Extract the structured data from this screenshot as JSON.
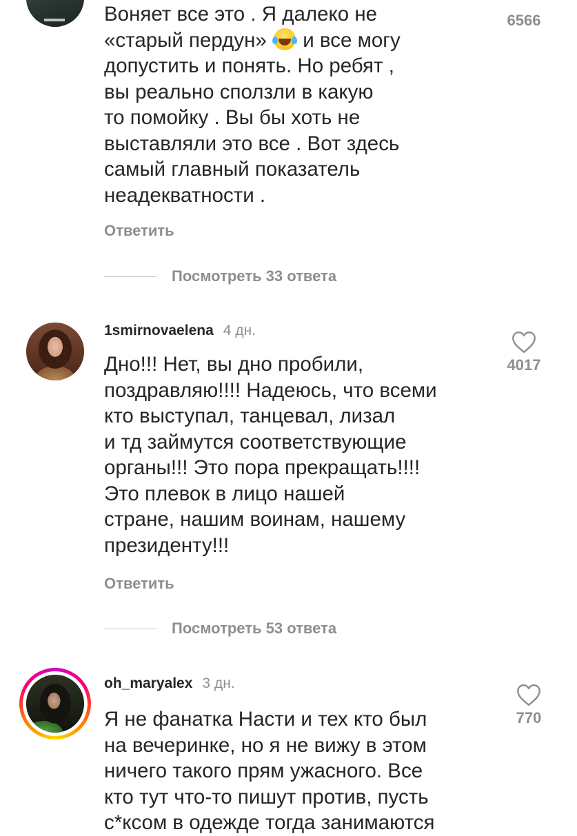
{
  "comments": [
    {
      "username": "",
      "time": "",
      "text_before_emoji": "Воняет все это . Я далеко не\n«старый пердун» ",
      "emoji": "face-with-tears-of-joy",
      "text_after_emoji": " и все могу\nдопустить и понять. Но ребят ,\nвы реально сползли в какую\nто помойку . Вы бы хоть не\nвыставляли это все . Вот здесь\nсамый главный показатель\nнеадекватности .",
      "likes": "6566",
      "reply_label": "Ответить",
      "view_replies": "Посмотреть 33 ответа"
    },
    {
      "username": "1smirnovaelena",
      "time": "4 дн.",
      "text": "Дно!!! Нет, вы дно пробили,\nпоздравляю!!!! Надеюсь, что всеми\nкто выступал, танцевал, лизал\nи тд займутся соответствующие\nорганы!!! Это пора прекращать!!!!\nЭто плевок в лицо нашей\nстране, нашим воинам, нашему\nпрезиденту!!!",
      "likes": "4017",
      "reply_label": "Ответить",
      "view_replies": "Посмотреть 53 ответа"
    },
    {
      "username": "oh_maryalex",
      "time": "3 дн.",
      "text": "Я не фанатка Насти и тех кто был\nна вечеринке, но я не вижу в этом\nничего такого прям ужасного. Все\nкто тут что-то пишут против, пусть\nс*ксом в одежде тогда занимаются",
      "likes": "770"
    }
  ],
  "colors": {
    "text": "#262626",
    "secondary": "#8e8e8e",
    "divider": "#c7c7c7",
    "story_ring": [
      "#d300c5",
      "#ff0069",
      "#ff7a00",
      "#ffd600"
    ]
  },
  "icons": {
    "like": "heart-outline-icon"
  }
}
